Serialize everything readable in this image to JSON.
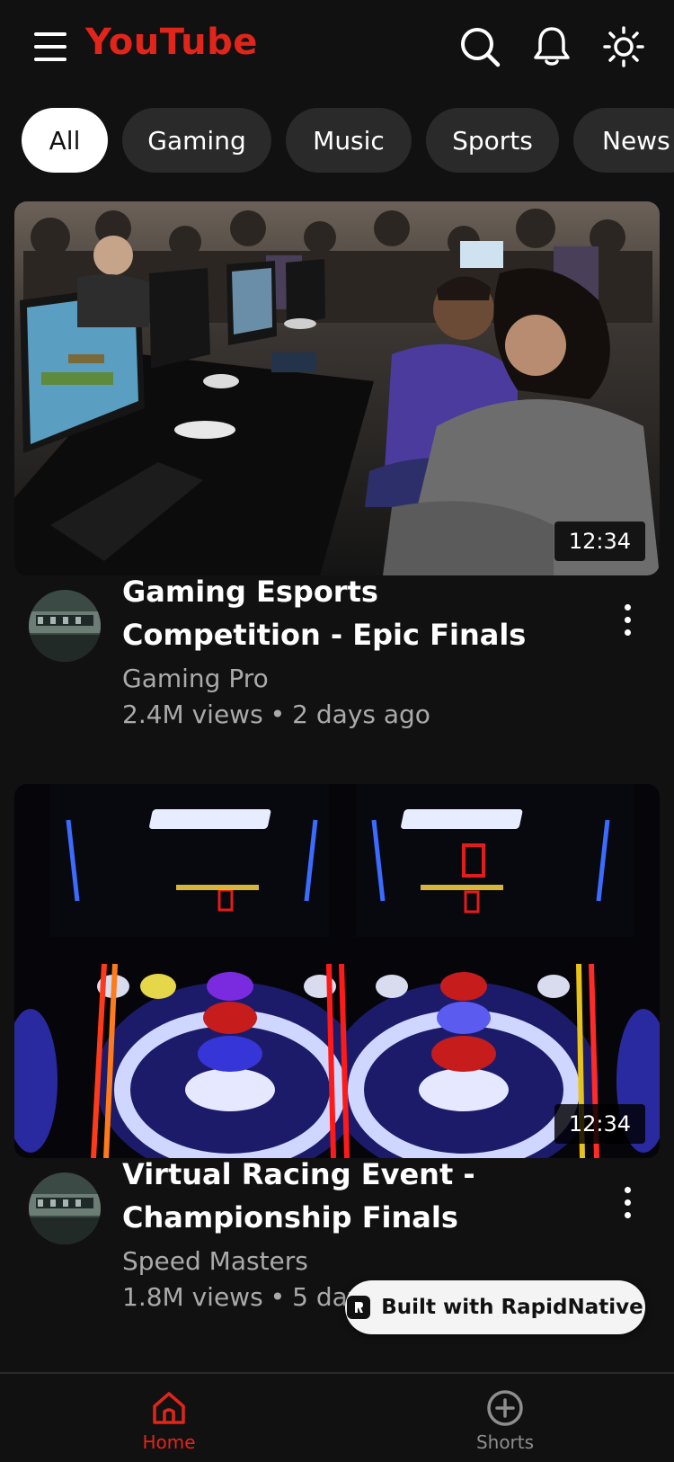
{
  "header": {
    "logo": "YouTube",
    "icons": [
      "menu-icon",
      "search-icon",
      "bell-icon",
      "sun-icon"
    ]
  },
  "chips": [
    {
      "label": "All",
      "active": true
    },
    {
      "label": "Gaming",
      "active": false
    },
    {
      "label": "Music",
      "active": false
    },
    {
      "label": "Sports",
      "active": false
    },
    {
      "label": "News",
      "active": false
    }
  ],
  "videos": [
    {
      "title": "Gaming Esports Competition - Epic Finals",
      "channel": "Gaming Pro",
      "views": "2.4M views",
      "separator": "•",
      "age": "2 days ago",
      "duration": "12:34"
    },
    {
      "title": "Virtual Racing Event - Championship Finals",
      "channel": "Speed Masters",
      "views": "1.8M views",
      "separator": "•",
      "age": "5 days ago",
      "duration": "12:34"
    }
  ],
  "badge": {
    "label": "Built with RapidNative"
  },
  "bottom_nav": [
    {
      "label": "Home",
      "icon": "home-icon",
      "active": true
    },
    {
      "label": "Shorts",
      "icon": "plus-circle-icon",
      "active": false
    }
  ],
  "colors": {
    "background": "#111111",
    "accent": "#e1251b",
    "chip": "#2a2a2a",
    "secondary_text": "#aaaaaa"
  }
}
